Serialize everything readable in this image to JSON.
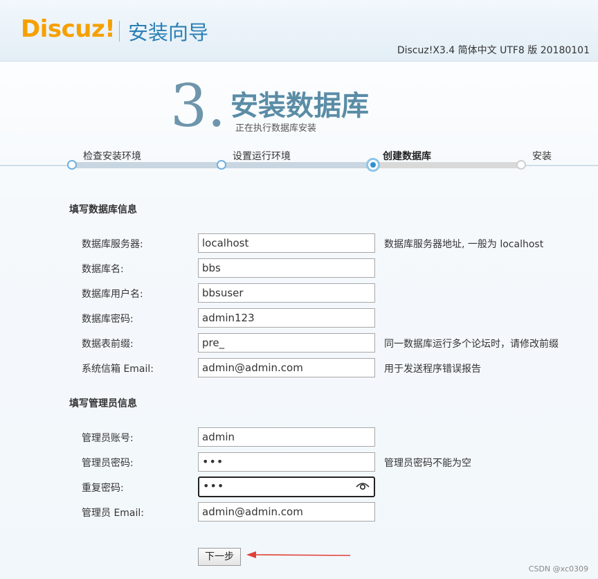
{
  "header": {
    "logo_text": "Discuz!",
    "wizard_title": "安装向导",
    "version": "Discuz!X3.4 简体中文 UTF8 版 20180101"
  },
  "step": {
    "number": "3.",
    "title": "安装数据库",
    "subtitle": "正在执行数据库安装"
  },
  "progress": {
    "steps": [
      {
        "label": "检查安装环境",
        "state": "done"
      },
      {
        "label": "设置运行环境",
        "state": "done"
      },
      {
        "label": "创建数据库",
        "state": "current"
      },
      {
        "label": "安装",
        "state": "todo"
      }
    ]
  },
  "db_section": {
    "title": "填写数据库信息",
    "rows": [
      {
        "label": "数据库服务器:",
        "value": "localhost",
        "hint": "数据库服务器地址, 一般为 localhost"
      },
      {
        "label": "数据库名:",
        "value": "bbs",
        "hint": ""
      },
      {
        "label": "数据库用户名:",
        "value": "bbsuser",
        "hint": ""
      },
      {
        "label": "数据库密码:",
        "value": "admin123",
        "hint": ""
      },
      {
        "label": "数据表前缀:",
        "value": "pre_",
        "hint": "同一数据库运行多个论坛时，请修改前缀"
      },
      {
        "label": "系统信箱 Email:",
        "value": "admin@admin.com",
        "hint": "用于发送程序错误报告"
      }
    ]
  },
  "admin_section": {
    "title": "填写管理员信息",
    "rows": [
      {
        "label": "管理员账号:",
        "value": "admin",
        "hint": ""
      },
      {
        "label": "管理员密码:",
        "value": "•••",
        "hint": "管理员密码不能为空"
      },
      {
        "label": "重复密码:",
        "value": "•••",
        "hint": ""
      },
      {
        "label": "管理员 Email:",
        "value": "admin@admin.com",
        "hint": ""
      }
    ]
  },
  "next_button": "下一步",
  "watermark": "CSDN @xc0309",
  "colors": {
    "logo": "#f6a000",
    "accent": "#2a7fb5",
    "arrow": "#e0403a"
  }
}
